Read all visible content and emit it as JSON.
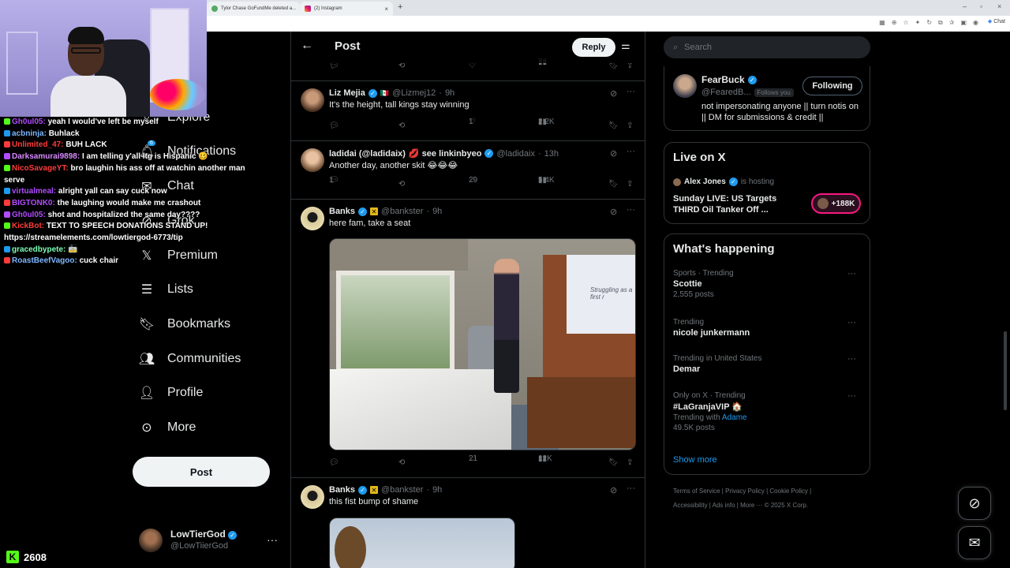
{
  "browser": {
    "tabs": [
      {
        "title": "Tylor Chase GoFundMe deleted a..."
      },
      {
        "title": "(2) Instagram"
      }
    ],
    "chat_label": "Chat"
  },
  "stream": {
    "chat": [
      {
        "user": "Gh0ul05:",
        "user_color": "#b14cff",
        "msg": "yeah I would've left be myself"
      },
      {
        "user": "acbninja:",
        "user_color": "#7db7ff",
        "msg": "Buhlack"
      },
      {
        "user": "Unlimited_47:",
        "user_color": "#ff3b3b",
        "msg": "BUH LACK"
      },
      {
        "user": "Darksamurai9898:",
        "user_color": "#d889ff",
        "msg": "I am telling y'all ltg is Hispanic 🥴"
      },
      {
        "user": "NicoSavageYT:",
        "user_color": "#ff3b3b",
        "msg": "bro laughin his ass off at watchin another man serve"
      },
      {
        "user": "virtualmeal:",
        "user_color": "#b14cff",
        "msg": "alright yall can say cuck now"
      },
      {
        "user": "BIGTONK0:",
        "user_color": "#b14cff",
        "msg": "the laughing would make me crashout"
      },
      {
        "user": "Gh0ul05:",
        "user_color": "#b14cff",
        "msg": "shot and hospitalized the same day????"
      },
      {
        "user": "KickBot:",
        "user_color": "#ff3b3b",
        "msg": "TEXT TO SPEECH DONATIONS STAND UP! https://streamelements.com/lowtiergod-6773/tip"
      },
      {
        "user": "gracedbypete:",
        "user_color": "#7dffb5",
        "msg": "🚋"
      },
      {
        "user": "RoastBeefVagoo:",
        "user_color": "#7db7ff",
        "msg": "cuck chair"
      }
    ],
    "viewer_count": "2608"
  },
  "nav": {
    "items": [
      {
        "label": "Explore",
        "icon": "search-icon"
      },
      {
        "label": "Notifications",
        "icon": "bell-icon",
        "badge": "6"
      },
      {
        "label": "Chat",
        "icon": "chat-icon"
      },
      {
        "label": "Grok",
        "icon": "grok-icon"
      },
      {
        "label": "Premium",
        "icon": "x-icon"
      },
      {
        "label": "Lists",
        "icon": "list-icon"
      },
      {
        "label": "Bookmarks",
        "icon": "bookmark-icon"
      },
      {
        "label": "Communities",
        "icon": "people-icon"
      },
      {
        "label": "Profile",
        "icon": "person-icon"
      },
      {
        "label": "More",
        "icon": "more-circle-icon"
      }
    ],
    "post_label": "Post",
    "account": {
      "name": "LowTierGod",
      "handle": "@LowTiierGod"
    }
  },
  "main": {
    "title": "Post",
    "reply_label": "Reply",
    "top_actions": {
      "views": "70"
    },
    "tweets": [
      {
        "name": "Liz Mejia",
        "handle": "@Lizmej12",
        "time": "9h",
        "text": "It's the height, tall kings stay winning",
        "replies": "",
        "likes": "1",
        "views": "2.2K"
      },
      {
        "name": "ladidai (@ladidaix)",
        "extra": "💋 see linkinbyeo",
        "handle": "@ladidaix",
        "time": "13h",
        "text": "Another day, another skit 😂😂😂",
        "replies": "1",
        "likes": "29",
        "views": "5.4K"
      },
      {
        "name": "Banks",
        "handle": "@bankster",
        "time": "9h",
        "text": "here fam, take a seat",
        "replies": "",
        "likes": "21",
        "views": "12K",
        "media_caption": "Struggling as a first r"
      },
      {
        "name": "Banks",
        "handle": "@bankster",
        "time": "9h",
        "text": "this fist bump of shame"
      }
    ]
  },
  "sidebar": {
    "search_placeholder": "Search",
    "follow": {
      "name": "FearBuck",
      "handle": "@FearedB...",
      "follows_you": "Follows you",
      "button": "Following",
      "bio": "not impersonating anyone || turn notis on || DM for submissions & credit ||"
    },
    "live": {
      "title": "Live on X",
      "host": "Alex Jones",
      "hosting": "is hosting",
      "desc": "Sunday LIVE: US Targets THIRD Oil Tanker Off ...",
      "count": "+188K"
    },
    "trends_title": "What's happening",
    "trends": [
      {
        "meta": "Sports · Trending",
        "name": "Scottie",
        "posts": "2,555 posts"
      },
      {
        "meta": "Trending",
        "name": "nicole junkermann",
        "posts": ""
      },
      {
        "meta": "Trending in United States",
        "name": "Demar",
        "posts": ""
      },
      {
        "meta": "Only on X · Trending",
        "name": "#LaGranjaVIP 🏠",
        "with_label": "Trending with",
        "with": "Adame",
        "posts": "49.5K posts"
      }
    ],
    "show_more": "Show more",
    "footer_line1": "Terms of Service  |  Privacy Policy  |  Cookie Policy  |",
    "footer_line2": "Accessibility  |  Ads info  |  More ···  © 2025 X Corp."
  }
}
